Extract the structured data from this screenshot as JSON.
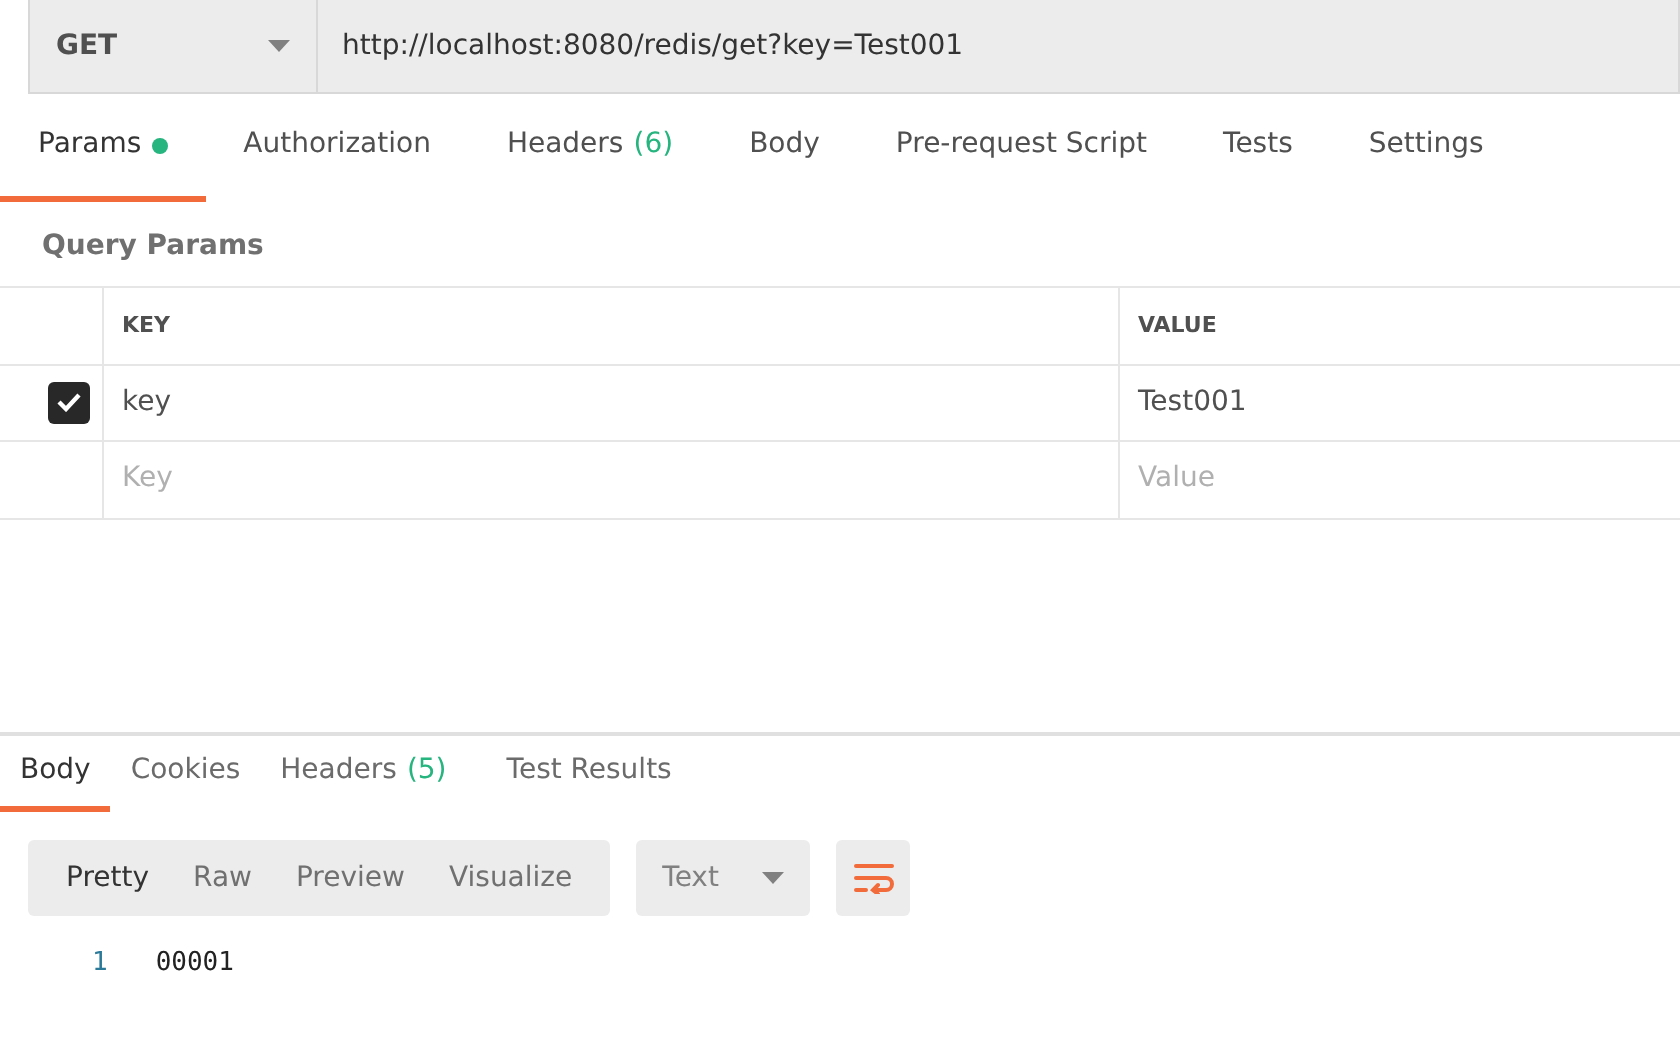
{
  "request": {
    "method": "GET",
    "url": "http://localhost:8080/redis/get?key=Test001"
  },
  "request_tabs": [
    {
      "label": "Params",
      "selected": true,
      "dot": true
    },
    {
      "label": "Authorization",
      "selected": false,
      "dot": false
    },
    {
      "label": "Headers",
      "count": "(6)",
      "selected": false,
      "dot": false
    },
    {
      "label": "Body",
      "selected": false,
      "dot": false
    },
    {
      "label": "Pre-request Script",
      "selected": false,
      "dot": false
    },
    {
      "label": "Tests",
      "selected": false,
      "dot": false
    },
    {
      "label": "Settings",
      "selected": false,
      "dot": false
    }
  ],
  "query_params": {
    "title": "Query Params",
    "columns": [
      "KEY",
      "VALUE"
    ],
    "rows": [
      {
        "checked": true,
        "key": "key",
        "value": "Test001"
      }
    ],
    "new_row": {
      "key_placeholder": "Key",
      "value_placeholder": "Value"
    }
  },
  "response_tabs": [
    {
      "label": "Body",
      "selected": true
    },
    {
      "label": "Cookies",
      "selected": false
    },
    {
      "label": "Headers",
      "count": "(5)",
      "selected": false
    },
    {
      "label": "Test Results",
      "selected": false
    }
  ],
  "view_modes": [
    {
      "label": "Pretty",
      "selected": true
    },
    {
      "label": "Raw",
      "selected": false
    },
    {
      "label": "Preview",
      "selected": false
    },
    {
      "label": "Visualize",
      "selected": false
    }
  ],
  "format": "Text",
  "code_lines": [
    {
      "number": "1",
      "text": "00001"
    }
  ]
}
